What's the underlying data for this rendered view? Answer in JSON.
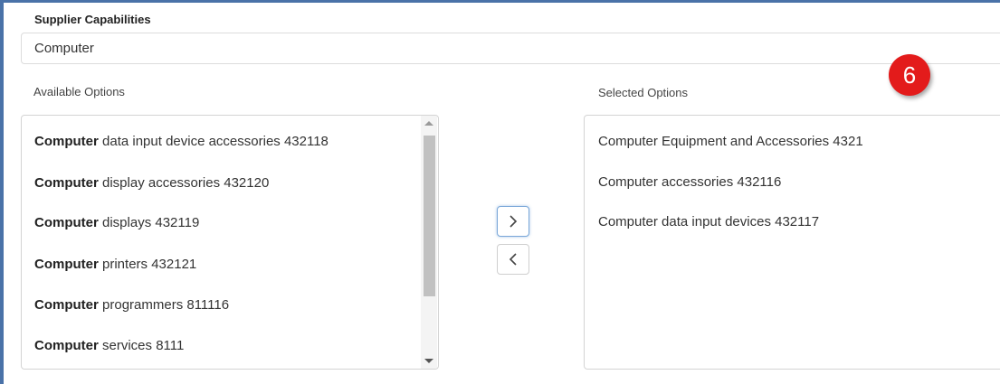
{
  "section_title": "Supplier Capabilities",
  "search": {
    "value": "Computer"
  },
  "available": {
    "label": "Available Options",
    "items": [
      {
        "bold": "Computer",
        "rest": " data input device accessories 432118"
      },
      {
        "bold": "Computer",
        "rest": " display accessories 432120"
      },
      {
        "bold": "Computer",
        "rest": " displays 432119"
      },
      {
        "bold": "Computer",
        "rest": " printers 432121"
      },
      {
        "bold": "Computer",
        "rest": " programmers 811116"
      },
      {
        "bold": "Computer",
        "rest": " services 8111"
      }
    ]
  },
  "selected": {
    "label": "Selected Options",
    "items": [
      "Computer Equipment and Accessories 4321",
      "Computer accessories 432116",
      "Computer data input devices 432117"
    ]
  },
  "annotation_badge": "6",
  "icons": {
    "add": "chevron-right-icon",
    "remove": "chevron-left-icon"
  },
  "colors": {
    "frame": "#4a72a8",
    "badge": "#e31b1b"
  }
}
